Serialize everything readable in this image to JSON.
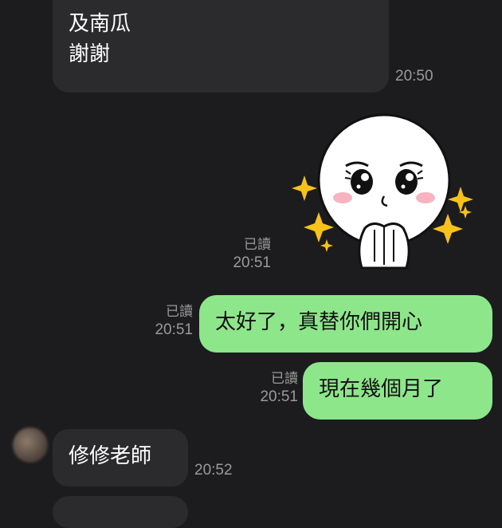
{
  "messages": [
    {
      "id": "m1",
      "direction": "incoming",
      "lines": [
        "及南瓜",
        "謝謝"
      ],
      "time": "20:50"
    },
    {
      "id": "m2",
      "direction": "outgoing",
      "type": "sticker",
      "sticker_name": "white-round-face-pleading-sticker",
      "read": "已讀",
      "time": "20:51"
    },
    {
      "id": "m3",
      "direction": "outgoing",
      "text": "太好了，真替你們開心",
      "read": "已讀",
      "time": "20:51"
    },
    {
      "id": "m4",
      "direction": "outgoing",
      "text": "現在幾個月了",
      "read": "已讀",
      "time": "20:51"
    },
    {
      "id": "m5",
      "direction": "incoming",
      "text": "修修老師",
      "time": "20:52"
    }
  ],
  "colors": {
    "background": "#1c1c1e",
    "incoming_bubble": "#2b2b2d",
    "outgoing_bubble": "#8ee68b",
    "meta_text": "#9a9a9a",
    "sparkle": "#f7c21b"
  }
}
